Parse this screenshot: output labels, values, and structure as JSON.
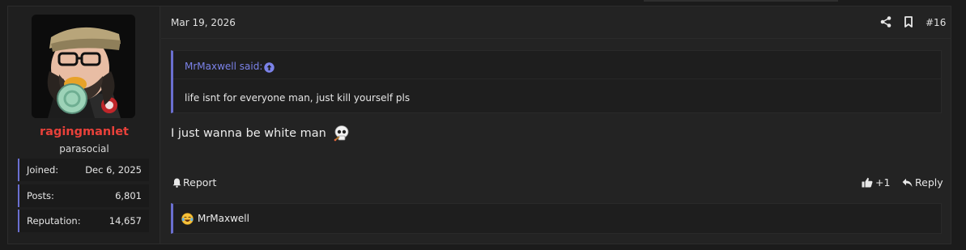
{
  "post": {
    "date": "Mar 19, 2026",
    "number": "#16",
    "message": "I just wanna be white man",
    "message_emoji": "skull-emoji"
  },
  "user": {
    "username": "ragingmanlet",
    "title": "parasocial",
    "stats": [
      {
        "label": "Joined:",
        "value": "Dec 6, 2025"
      },
      {
        "label": "Posts:",
        "value": "6,801"
      },
      {
        "label": "Reputation:",
        "value": "14,657"
      }
    ]
  },
  "quote": {
    "author": "MrMaxwell said:",
    "body": "life isnt for everyone man, just kill yourself pls"
  },
  "actions": {
    "report": "Report",
    "like_count": "+1",
    "reply": "Reply"
  },
  "reactions": {
    "emoji": "laughing-tears-emoji",
    "users": "MrMaxwell"
  },
  "icons": {
    "share": "share-icon",
    "bookmark": "bookmark-icon",
    "report": "bell-icon",
    "like": "thumbs-up-icon",
    "reply": "reply-icon",
    "quote_jump": "arrow-up-circle-icon"
  },
  "colors": {
    "accent": "#6a6fd0",
    "username": "#e8413a",
    "quote_link": "#7b82e8"
  }
}
